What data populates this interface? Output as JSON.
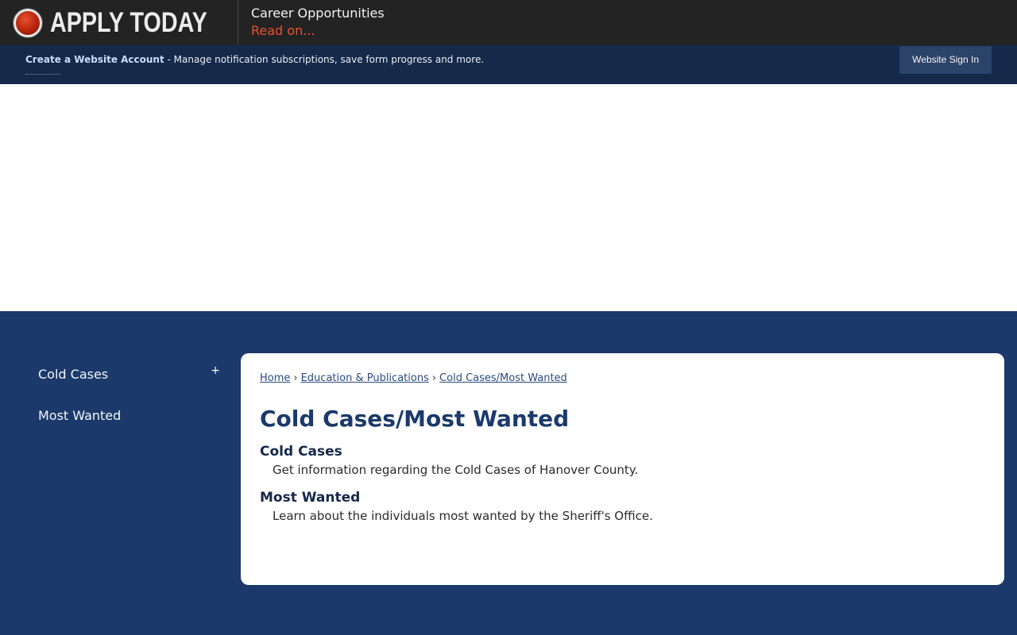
{
  "alert": {
    "title": "APPLY TODAY",
    "heading": "Career Opportunities",
    "link": "Read on..."
  },
  "account": {
    "link_label": "Create a Website Account",
    "description": " - Manage notification subscriptions, save form progress and more.",
    "signin_label": "Website Sign In"
  },
  "sidebar": {
    "items": [
      {
        "label": "Cold Cases",
        "expand": "+"
      },
      {
        "label": "Most Wanted"
      }
    ]
  },
  "breadcrumb": {
    "items": [
      "Home",
      "Education & Publications",
      "Cold Cases/Most Wanted"
    ],
    "separator": "›"
  },
  "main": {
    "title": "Cold Cases/Most Wanted",
    "sections": [
      {
        "title": "Cold Cases",
        "description": "Get information regarding the Cold Cases of Hanover County."
      },
      {
        "title": "Most Wanted",
        "description": "Learn about the individuals most wanted by the Sheriff's Office."
      }
    ]
  },
  "colors": {
    "navy": "#1b3a6b",
    "dark_bar": "#232323",
    "account_bar": "#15294a",
    "alert_link": "#e8522e"
  },
  "icons": {
    "alert": "red-record-dot-icon",
    "expand": "plus-icon"
  }
}
